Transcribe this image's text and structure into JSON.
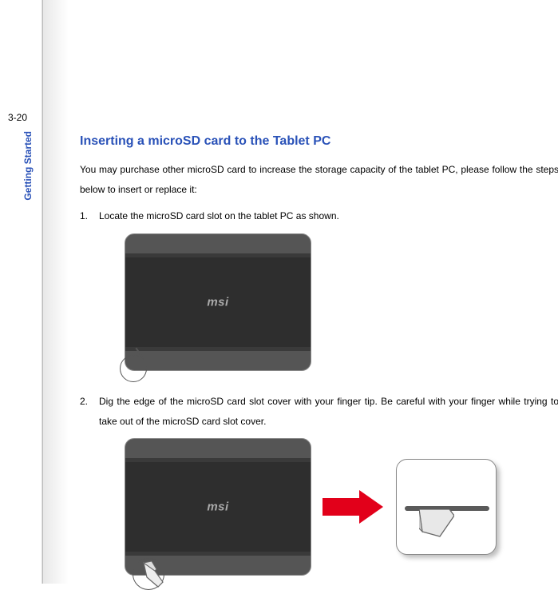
{
  "page_number": "3-20",
  "section_tab": "Getting Started",
  "heading": "Inserting a microSD card to the Tablet PC",
  "intro": "You may purchase other microSD card to increase the storage capacity of the tablet PC, please follow the steps below to insert or replace it:",
  "steps": [
    {
      "num": "1.",
      "text": "Locate the microSD card slot on the tablet PC as shown."
    },
    {
      "num": "2.",
      "text": "Dig the edge of the microSD card slot cover with your finger tip. Be careful with your finger while trying to take out of the microSD card slot cover."
    }
  ],
  "brand_logo_text": "msi"
}
